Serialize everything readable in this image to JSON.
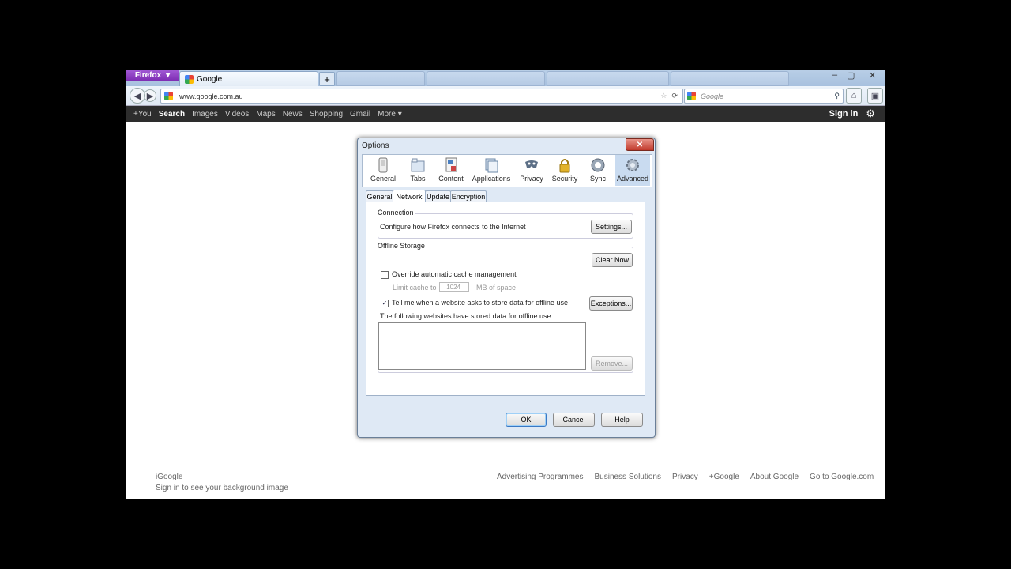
{
  "browser": {
    "firefox_button": "Firefox",
    "active_tab_title": "Google",
    "new_tab_symbol": "+",
    "url": "www.google.com.au",
    "search_placeholder": "Google",
    "window_controls": [
      "–",
      "▢",
      "✕"
    ]
  },
  "google_bar": {
    "items": [
      "+You",
      "Search",
      "Images",
      "Videos",
      "Maps",
      "News",
      "Shopping",
      "Gmail",
      "More ▾"
    ],
    "selected": "Search",
    "sign_in": "Sign in"
  },
  "google_footer": {
    "igoogle": "iGoogle",
    "background_hint": "Sign in to see your background image",
    "links": [
      "Advertising Programmes",
      "Business Solutions",
      "Privacy",
      "+Google",
      "About Google",
      "Go to Google.com"
    ]
  },
  "dialog": {
    "title": "Options",
    "close": "✕",
    "panes": [
      {
        "label": "General",
        "icon": "general-switch-icon"
      },
      {
        "label": "Tabs",
        "icon": "tabs-icon"
      },
      {
        "label": "Content",
        "icon": "content-icon"
      },
      {
        "label": "Applications",
        "icon": "applications-icon"
      },
      {
        "label": "Privacy",
        "icon": "privacy-mask-icon"
      },
      {
        "label": "Security",
        "icon": "security-lock-icon"
      },
      {
        "label": "Sync",
        "icon": "sync-icon"
      },
      {
        "label": "Advanced",
        "icon": "advanced-gear-icon"
      }
    ],
    "active_pane": "Advanced",
    "subtabs": [
      "General",
      "Network",
      "Update",
      "Encryption"
    ],
    "active_subtab": "Network",
    "connection": {
      "title": "Connection",
      "description": "Configure how Firefox connects to the Internet",
      "settings_button": "Settings..."
    },
    "offline_storage": {
      "title": "Offline Storage",
      "clear_button": "Clear Now",
      "override_label": "Override automatic cache management",
      "override_checked": false,
      "limit_label": "Limit cache to",
      "limit_value": "1024",
      "limit_unit": "MB of space",
      "tell_me_label": "Tell me when a website asks to store data for offline use",
      "tell_me_checked": true,
      "exceptions_button": "Exceptions...",
      "list_label": "The following websites have stored data for offline use:",
      "remove_button": "Remove..."
    },
    "buttons": {
      "ok": "OK",
      "cancel": "Cancel",
      "help": "Help"
    }
  },
  "colors": {
    "firefox_purple": "#7c2ab1",
    "google_bar": "#2d2d2d",
    "dialog_bg": "#dfe9f5"
  }
}
